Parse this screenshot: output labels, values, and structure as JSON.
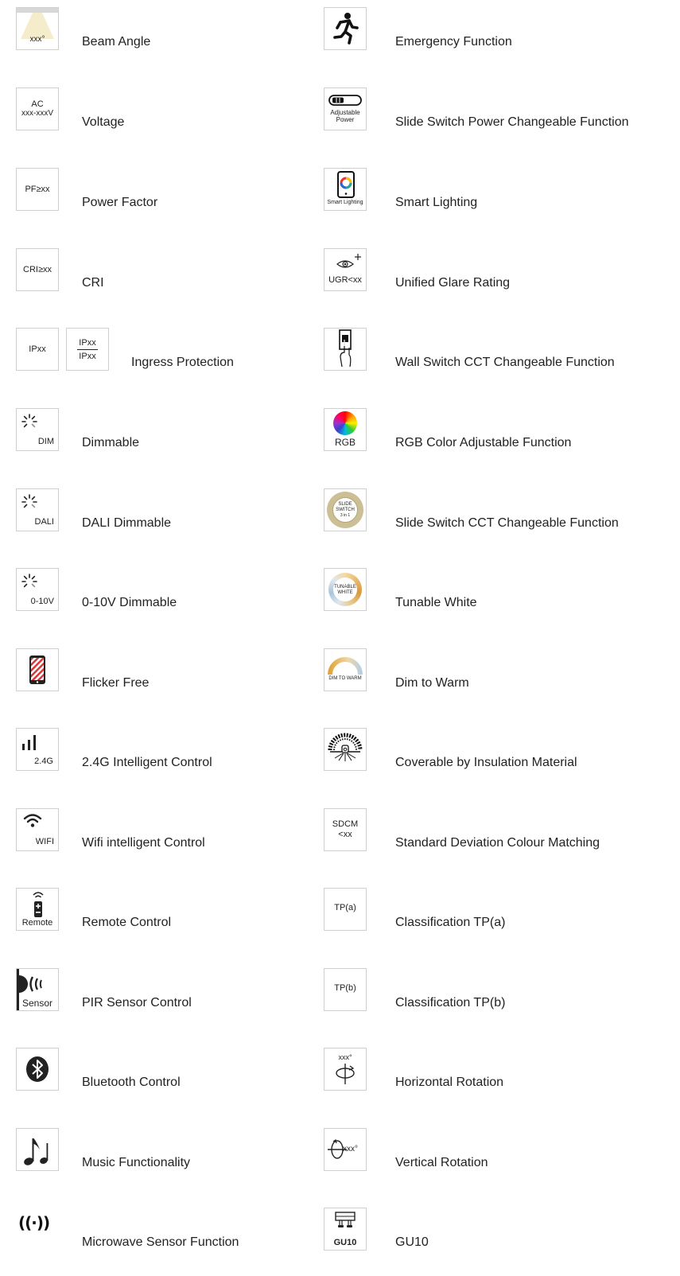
{
  "left_items": [
    {
      "label": "Beam Angle",
      "icon": "beam-angle-icon",
      "icon_text": "xxx°"
    },
    {
      "label": "Voltage",
      "icon": "voltage-icon",
      "icon_text_1": "AC",
      "icon_text_2": "xxx-xxxV"
    },
    {
      "label": "Power Factor",
      "icon": "power-factor-icon",
      "icon_text": "PF≥xx"
    },
    {
      "label": "CRI",
      "icon": "cri-icon",
      "icon_text": "CRI≥xx"
    },
    {
      "label": "Ingress Protection",
      "icon": "ip-icon",
      "icon_text": "IPxx",
      "icon2_text_1": "IPxx",
      "icon2_text_2": "IPxx"
    },
    {
      "label": "Dimmable",
      "icon": "dim-icon",
      "icon_text": "DIM"
    },
    {
      "label": "DALI Dimmable",
      "icon": "dali-icon",
      "icon_text": "DALI"
    },
    {
      "label": "0-10V Dimmable",
      "icon": "0-10v-icon",
      "icon_text": "0-10V"
    },
    {
      "label": "Flicker Free",
      "icon": "flicker-free-icon"
    },
    {
      "label": "2.4G Intelligent Control",
      "icon": "signal-icon",
      "icon_text": "2.4G"
    },
    {
      "label": "Wifi intelligent Control",
      "icon": "wifi-icon",
      "icon_text": "WIFI"
    },
    {
      "label": "Remote Control",
      "icon": "remote-icon",
      "icon_text": "Remote"
    },
    {
      "label": "PIR Sensor Control",
      "icon": "pir-sensor-icon",
      "icon_text": "Sensor"
    },
    {
      "label": "Bluetooth Control",
      "icon": "bluetooth-icon"
    },
    {
      "label": "Music Functionality",
      "icon": "music-note-icon"
    },
    {
      "label": "Microwave Sensor Function",
      "icon": "microwave-sensor-icon",
      "icon_text": "((·))"
    }
  ],
  "right_items": [
    {
      "label": "Emergency Function",
      "icon": "running-man-icon"
    },
    {
      "label": "Slide Switch Power Changeable Function",
      "icon": "adjustable-power-icon",
      "icon_text_1": "Adjustable",
      "icon_text_2": "Power"
    },
    {
      "label": "Smart Lighting",
      "icon": "smartphone-icon",
      "icon_text": "Smart Lighting"
    },
    {
      "label": "Unified Glare Rating",
      "icon": "eye-icon",
      "icon_text": "UGR<xx"
    },
    {
      "label": "Wall Switch CCT Changeable Function",
      "icon": "wall-switch-icon"
    },
    {
      "label": "RGB Color Adjustable Function",
      "icon": "rgb-wheel-icon",
      "icon_text": "RGB"
    },
    {
      "label": "Slide Switch CCT Changeable Function",
      "icon": "slide-switch-badge-icon",
      "icon_text_1": "SLIDE",
      "icon_text_2": "SWITCH",
      "icon_text_3": "3 in 1"
    },
    {
      "label": "Tunable White",
      "icon": "tunable-white-icon",
      "icon_text_1": "TUNABLE",
      "icon_text_2": "WHITE"
    },
    {
      "label": "Dim to Warm",
      "icon": "dim-to-warm-icon",
      "icon_text": "DIM TO WARM"
    },
    {
      "label": "Coverable by Insulation Material",
      "icon": "insulation-icon"
    },
    {
      "label": "Standard Deviation Colour Matching",
      "icon": "sdcm-icon",
      "icon_text_1": "SDCM",
      "icon_text_2": "<xx"
    },
    {
      "label": "Classification TP(a)",
      "icon": "tpa-icon",
      "icon_text": "TP(a)"
    },
    {
      "label": "Classification TP(b)",
      "icon": "tpb-icon",
      "icon_text": "TP(b)"
    },
    {
      "label": "Horizontal Rotation",
      "icon": "horizontal-rotation-icon",
      "icon_text": "xxx°"
    },
    {
      "label": "Vertical Rotation",
      "icon": "vertical-rotation-icon",
      "icon_text": "xxx°"
    },
    {
      "label": "GU10",
      "icon": "gu10-icon",
      "icon_text": "GU10"
    }
  ]
}
